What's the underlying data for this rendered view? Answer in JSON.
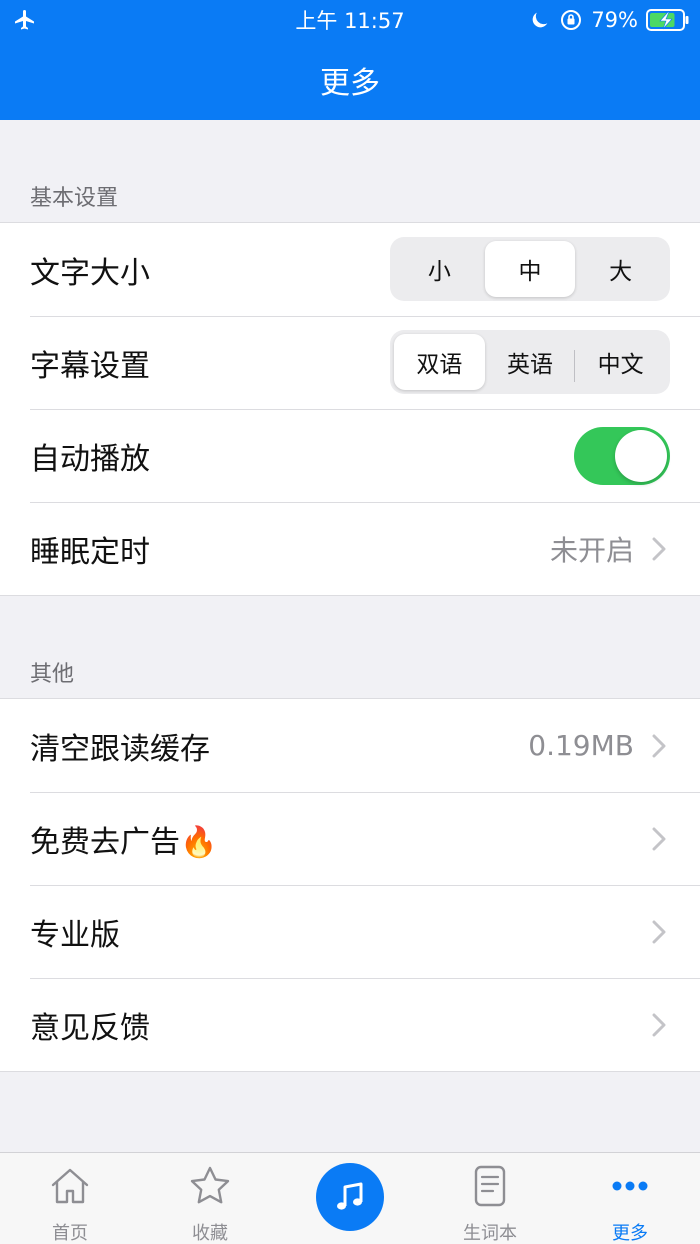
{
  "status_bar": {
    "time": "上午 11:57",
    "battery_percent": "79%",
    "battery_level": 0.79
  },
  "nav": {
    "title": "更多"
  },
  "basic_settings": {
    "header": "基本设置",
    "font_size": {
      "label": "文字大小",
      "options": [
        "小",
        "中",
        "大"
      ],
      "selected": "中"
    },
    "subtitle": {
      "label": "字幕设置",
      "options": [
        "双语",
        "英语",
        "中文"
      ],
      "selected": "双语"
    },
    "autoplay": {
      "label": "自动播放",
      "on": true
    },
    "sleep_timer": {
      "label": "睡眠定时",
      "value": "未开启"
    }
  },
  "other": {
    "header": "其他",
    "clear_cache": {
      "label": "清空跟读缓存",
      "value": "0.19MB"
    },
    "remove_ads": {
      "label": "免费去广告",
      "emoji": "🔥"
    },
    "pro": {
      "label": "专业版"
    },
    "feedback": {
      "label": "意见反馈"
    }
  },
  "tabbar": {
    "home": "首页",
    "favorites": "收藏",
    "vocab": "生词本",
    "more": "更多",
    "active": "more"
  },
  "colors": {
    "accent": "#0a7bf5",
    "toggle_on": "#34c759",
    "background": "#f1f1f5"
  }
}
